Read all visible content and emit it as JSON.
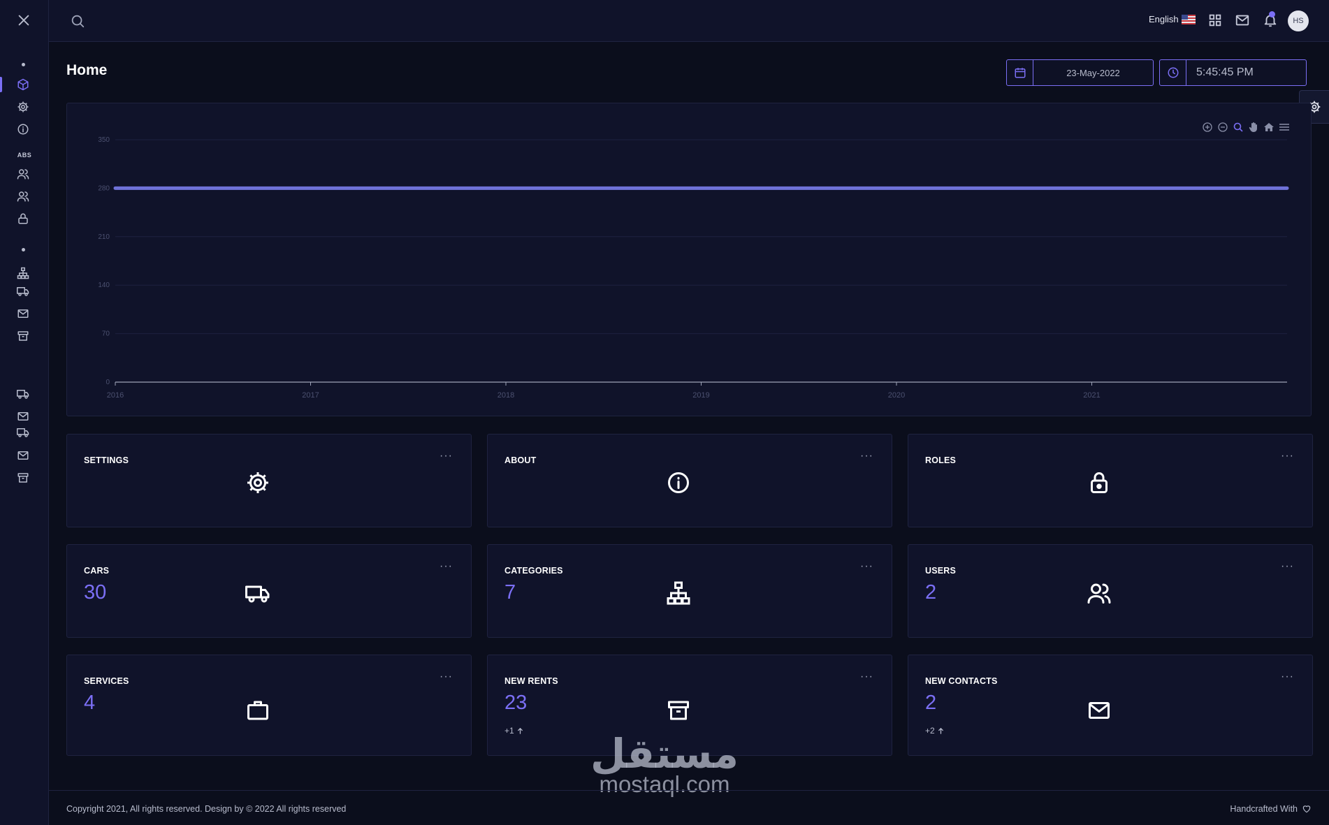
{
  "header": {
    "language": "English",
    "avatar_initials": "HS"
  },
  "sidebar": {
    "section_label": "ABS"
  },
  "page": {
    "title": "Home",
    "date": "23-May-2022",
    "time": "5:45:45 PM"
  },
  "chart_data": {
    "type": "line",
    "x": [
      "2016",
      "2017",
      "2018",
      "2019",
      "2020",
      "2021"
    ],
    "x_range": [
      2016,
      2022
    ],
    "series": [
      {
        "values": [
          [
            2016,
            280
          ],
          [
            2022,
            280
          ]
        ],
        "color": "#6f72d8"
      }
    ],
    "y_ticks": [
      0,
      70,
      140,
      210,
      280,
      350
    ],
    "ylim": [
      0,
      350
    ],
    "grid": true
  },
  "cards": [
    {
      "title": "SETTINGS",
      "value": "",
      "delta": "",
      "icon": "gear-icon"
    },
    {
      "title": "ABOUT",
      "value": "",
      "delta": "",
      "icon": "info-icon"
    },
    {
      "title": "ROLES",
      "value": "",
      "delta": "",
      "icon": "lock-icon"
    },
    {
      "title": "CARS",
      "value": "30",
      "delta": "",
      "icon": "truck-icon"
    },
    {
      "title": "CATEGORIES",
      "value": "7",
      "delta": "",
      "icon": "sitemap-icon"
    },
    {
      "title": "USERS",
      "value": "2",
      "delta": "",
      "icon": "users-icon"
    },
    {
      "title": "SERVICES",
      "value": "4",
      "delta": "",
      "icon": "briefcase-icon"
    },
    {
      "title": "NEW RENTS",
      "value": "23",
      "delta": "+1",
      "icon": "archive-icon"
    },
    {
      "title": "NEW CONTACTS",
      "value": "2",
      "delta": "+2",
      "icon": "mail-icon"
    }
  ],
  "card_more_label": "···",
  "watermark": {
    "arabic": "مستقل",
    "latin": "mostaql.com"
  },
  "footer": {
    "copyright": "Copyright 2021, All rights reserved. Design by © 2022 All rights reserved",
    "handcrafted": "Handcrafted With"
  },
  "colors": {
    "accent": "#7b6ff5",
    "background": "#0b0e1c",
    "panel": "#10132a"
  }
}
